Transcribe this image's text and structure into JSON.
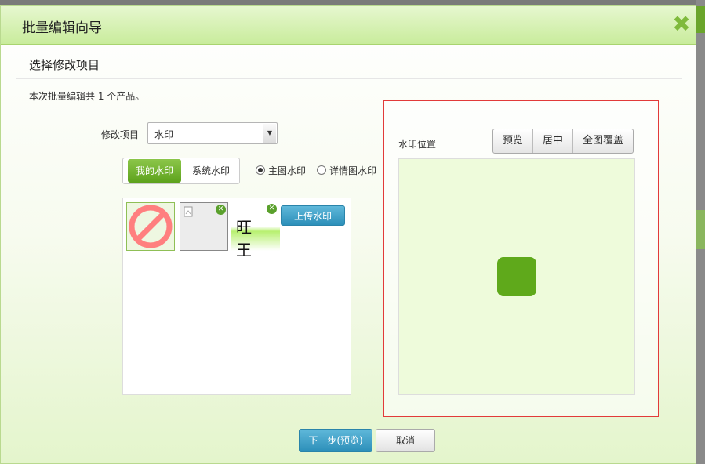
{
  "dialog": {
    "title": "批量编辑向导",
    "close_icon": "close-icon",
    "section_title": "选择修改项目",
    "summary": "本次批量编辑共 1 个产品。"
  },
  "form": {
    "item_label": "修改项目",
    "item_value": "水印"
  },
  "tabs": {
    "mine": "我的水印",
    "system": "系统水印"
  },
  "radios": [
    {
      "label": "主图水印",
      "checked": true
    },
    {
      "label": "详情图水印",
      "checked": false
    }
  ],
  "watermarks": {
    "thumb3_text": "旺 王",
    "upload_label": "上传水印"
  },
  "position": {
    "label": "水印位置",
    "buttons": [
      "预览",
      "居中",
      "全图覆盖"
    ],
    "marker_color": "#5fa91b"
  },
  "footer": {
    "next": "下一步(预览)",
    "cancel": "取消"
  }
}
